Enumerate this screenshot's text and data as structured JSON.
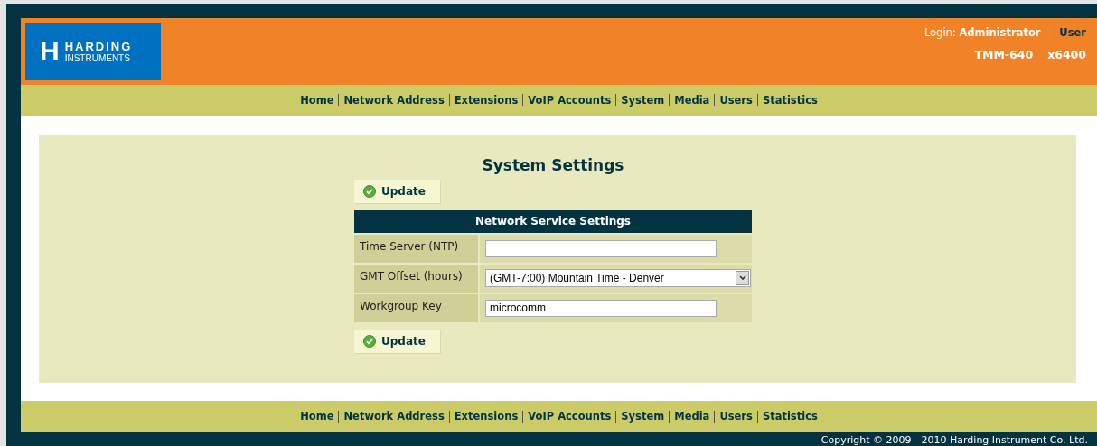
{
  "logo": {
    "title": "HARDING",
    "subtitle": "INSTRUMENTS",
    "mark": "H"
  },
  "header": {
    "login_label": "Login:",
    "login_user": "Administrator",
    "separator": "|",
    "user_link": "User",
    "model": "TMM-640",
    "extension": "x6400"
  },
  "nav_top": [
    "Home",
    "Network Address",
    "Extensions",
    "VoIP Accounts",
    "System",
    "Media",
    "Users",
    "Statistics"
  ],
  "page_title": "System Settings",
  "update_buttons": [
    "Update",
    "Update"
  ],
  "table": {
    "heading": "Network Service Settings",
    "rows": [
      {
        "kind": "text",
        "label": "Time Server (NTP)",
        "value": ""
      },
      {
        "kind": "select",
        "label": "GMT Offset (hours)",
        "value": "(GMT-7:00) Mountain Time - Denver"
      },
      {
        "kind": "text",
        "label": "Workgroup Key",
        "value": "microcomm"
      }
    ]
  },
  "nav_bottom": [
    "Home",
    "Network Address",
    "Extensions",
    "VoIP Accounts",
    "System",
    "Media",
    "Users",
    "Statistics"
  ],
  "copyright": "Copyright © 2009 - 2010 Harding Instrument Co. Ltd."
}
